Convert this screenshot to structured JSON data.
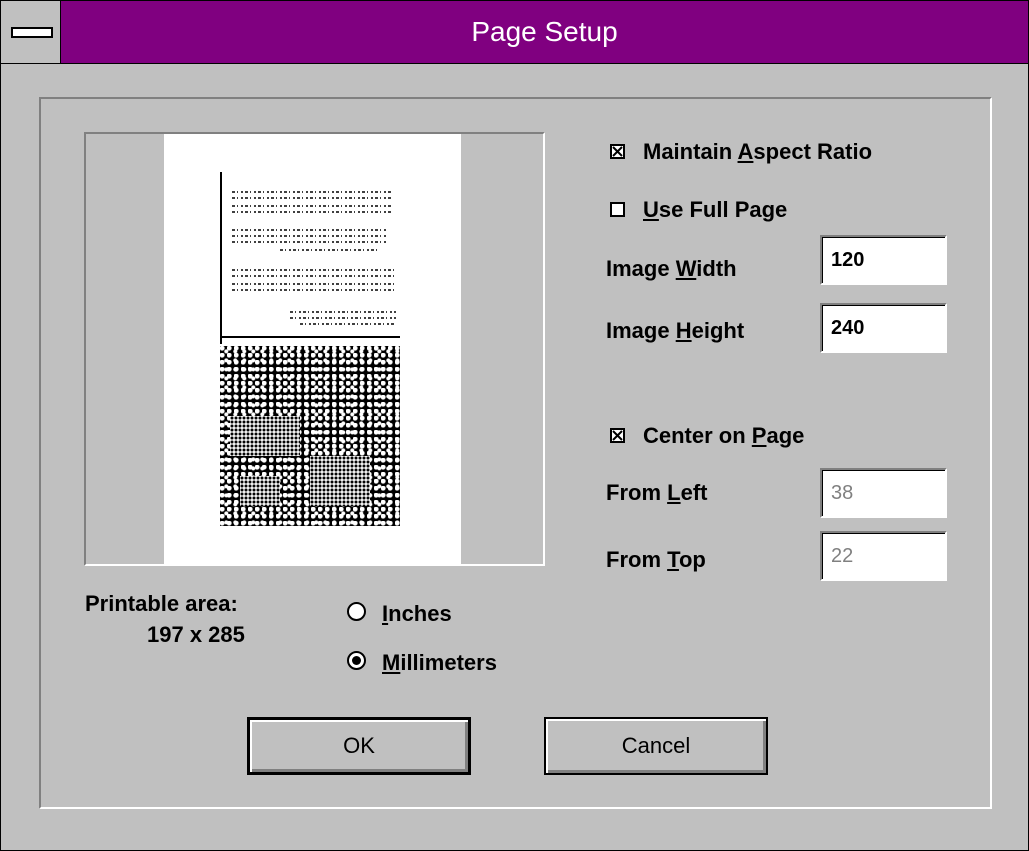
{
  "window": {
    "title": "Page Setup",
    "system_menu": "system-menu"
  },
  "preview": {
    "printable_area_label": "Printable area:",
    "printable_area_value": "197 x 285"
  },
  "units": {
    "options": [
      {
        "label": "Inches",
        "selected": false
      },
      {
        "label": "Millimeters",
        "selected": true
      }
    ]
  },
  "options": {
    "maintain_aspect": {
      "label": "Maintain Aspect Ratio",
      "checked": true
    },
    "use_full_page": {
      "label": "Use Full Page",
      "checked": false
    },
    "center_on_page": {
      "label": "Center on Page",
      "checked": true
    }
  },
  "fields": {
    "image_width": {
      "label": "Image Width",
      "value": "120"
    },
    "image_height": {
      "label": "Image Height",
      "value": "240"
    },
    "from_left": {
      "label": "From Left",
      "value": "38"
    },
    "from_top": {
      "label": "From Top",
      "value": "22"
    }
  },
  "buttons": {
    "ok": "OK",
    "cancel": "Cancel"
  }
}
